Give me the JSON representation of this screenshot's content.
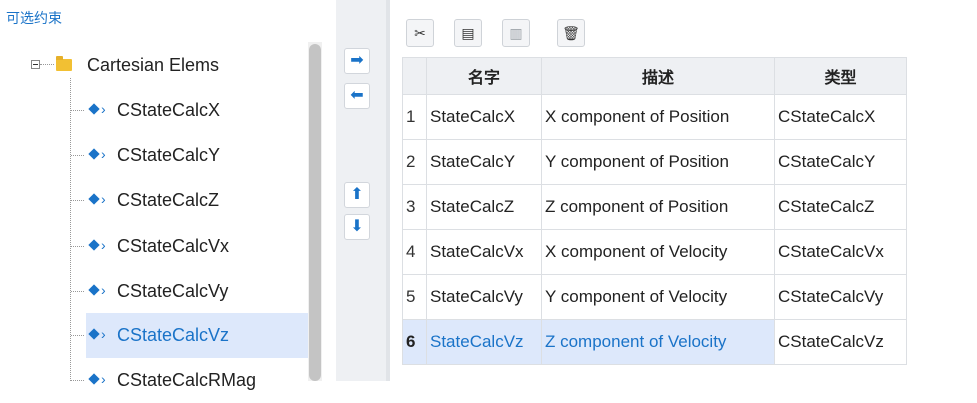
{
  "left_panel": {
    "title": "可选约束",
    "tree": {
      "root_label": "Cartesian Elems",
      "items": [
        {
          "label": "CStateCalcX"
        },
        {
          "label": "CStateCalcY"
        },
        {
          "label": "CStateCalcZ"
        },
        {
          "label": "CStateCalcVx"
        },
        {
          "label": "CStateCalcVy"
        },
        {
          "label": "CStateCalcVz",
          "selected": true
        },
        {
          "label": "CStateCalcRMag"
        }
      ]
    }
  },
  "middle_buttons": {
    "add": "➡",
    "remove": "⬅",
    "move_up": "⬆",
    "move_down": "⬇"
  },
  "toolbar": {
    "cut_icon": "✂",
    "copy_icon": "▤",
    "paste_icon": "▥",
    "delete_icon": "🗑"
  },
  "table": {
    "headers": [
      "名字",
      "描述",
      "类型"
    ],
    "rows": [
      {
        "num": "1",
        "name": "StateCalcX",
        "desc": "X component of Position",
        "type": "CStateCalcX"
      },
      {
        "num": "2",
        "name": "StateCalcY",
        "desc": "Y component of Position",
        "type": "CStateCalcY"
      },
      {
        "num": "3",
        "name": "StateCalcZ",
        "desc": "Z component of Position",
        "type": "CStateCalcZ"
      },
      {
        "num": "4",
        "name": "StateCalcVx",
        "desc": "X component of Velocity",
        "type": "CStateCalcVx"
      },
      {
        "num": "5",
        "name": "StateCalcVy",
        "desc": "Y component of Velocity",
        "type": "CStateCalcVy"
      },
      {
        "num": "6",
        "name": "StateCalcVz",
        "desc": "Z component of Velocity",
        "type": "CStateCalcVz",
        "selected": true
      }
    ]
  },
  "colors": {
    "accent": "#1a73c8",
    "selection": "#dde8fb",
    "folder": "#f2c033"
  }
}
